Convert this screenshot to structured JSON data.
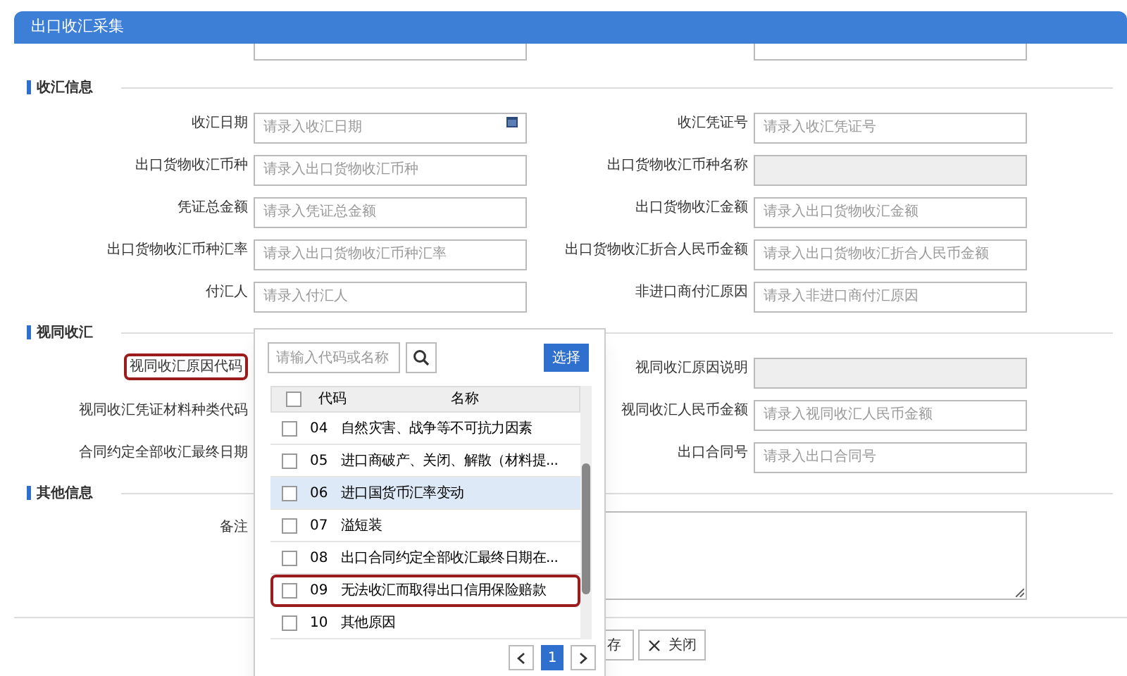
{
  "window": {
    "title": "出口收汇采集"
  },
  "sections": [
    {
      "title": "收汇信息",
      "fields": [
        {
          "label": "收汇日期",
          "placeholder": "请录入收汇日期",
          "kind": "date",
          "highlighted": false
        },
        {
          "label": "收汇凭证号",
          "placeholder": "请录入收汇凭证号",
          "kind": "text",
          "highlighted": false
        },
        {
          "label": "出口货物收汇币种",
          "placeholder": "请录入出口货物收汇币种",
          "kind": "text",
          "highlighted": false
        },
        {
          "label": "出口货物收汇币种名称",
          "kind": "disabled",
          "highlighted": false
        },
        {
          "label": "凭证总金额",
          "placeholder": "请录入凭证总金额",
          "kind": "text",
          "highlighted": false
        },
        {
          "label": "出口货物收汇金额",
          "placeholder": "请录入出口货物收汇金额",
          "kind": "text",
          "highlighted": false
        },
        {
          "label": "出口货物收汇币种汇率",
          "placeholder": "请录入出口货物收汇币种汇率",
          "kind": "text",
          "highlighted": false
        },
        {
          "label": "出口货物收汇折合人民币金额",
          "placeholder": "请录入出口货物收汇折合人民币金额",
          "kind": "text",
          "highlighted": false
        },
        {
          "label": "付汇人",
          "placeholder": "请录入付汇人",
          "kind": "text",
          "highlighted": false
        },
        {
          "label": "非进口商付汇原因",
          "placeholder": "请录入非进口商付汇原因",
          "kind": "text",
          "highlighted": false
        }
      ]
    },
    {
      "title": "视同收汇",
      "fields": [
        {
          "label": "视同收汇原因代码",
          "kind": "covered",
          "highlighted": true
        },
        {
          "label": "视同收汇原因说明",
          "kind": "disabled",
          "highlighted": false
        },
        {
          "label": "视同收汇凭证材料种类代码",
          "kind": "covered",
          "highlighted": false
        },
        {
          "label": "视同收汇人民币金额",
          "placeholder": "请录入视同收汇人民币金额",
          "kind": "text",
          "highlighted": false
        },
        {
          "label": "合同约定全部收汇最终日期",
          "kind": "covered",
          "highlighted": false
        },
        {
          "label": "出口合同号",
          "placeholder": "请录入出口合同号",
          "kind": "text",
          "highlighted": false
        }
      ]
    },
    {
      "title": "其他信息",
      "fields": [
        {
          "label": "备注",
          "kind": "textarea",
          "highlighted": false
        }
      ]
    }
  ],
  "buttons": [
    {
      "label": "存",
      "kind": "save"
    },
    {
      "label": "关闭",
      "kind": "close"
    }
  ],
  "picker": {
    "search": {
      "placeholder": "请输入代码或名称"
    },
    "select_button": "选择",
    "all_checked": false,
    "columns": [
      "代码",
      "名称"
    ],
    "rows": [
      {
        "code": "04",
        "name": "自然灾害、战争等不可抗力因素",
        "checked": false,
        "selected": false,
        "highlighted": false
      },
      {
        "code": "05",
        "name": "进口商破产、关闭、解散（材料提...",
        "checked": false,
        "selected": false,
        "highlighted": false
      },
      {
        "code": "06",
        "name": "进口国货币汇率变动",
        "checked": false,
        "selected": true,
        "highlighted": false
      },
      {
        "code": "07",
        "name": "溢短装",
        "checked": false,
        "selected": false,
        "highlighted": false
      },
      {
        "code": "08",
        "name": "出口合同约定全部收汇最终日期在...",
        "checked": false,
        "selected": false,
        "highlighted": false
      },
      {
        "code": "09",
        "name": "无法收汇而取得出口信用保险赔款",
        "checked": false,
        "selected": false,
        "highlighted": true
      },
      {
        "code": "10",
        "name": "其他原因",
        "checked": false,
        "selected": false,
        "highlighted": false
      }
    ],
    "pages": [
      {
        "label": "1",
        "selected": true
      }
    ]
  }
}
